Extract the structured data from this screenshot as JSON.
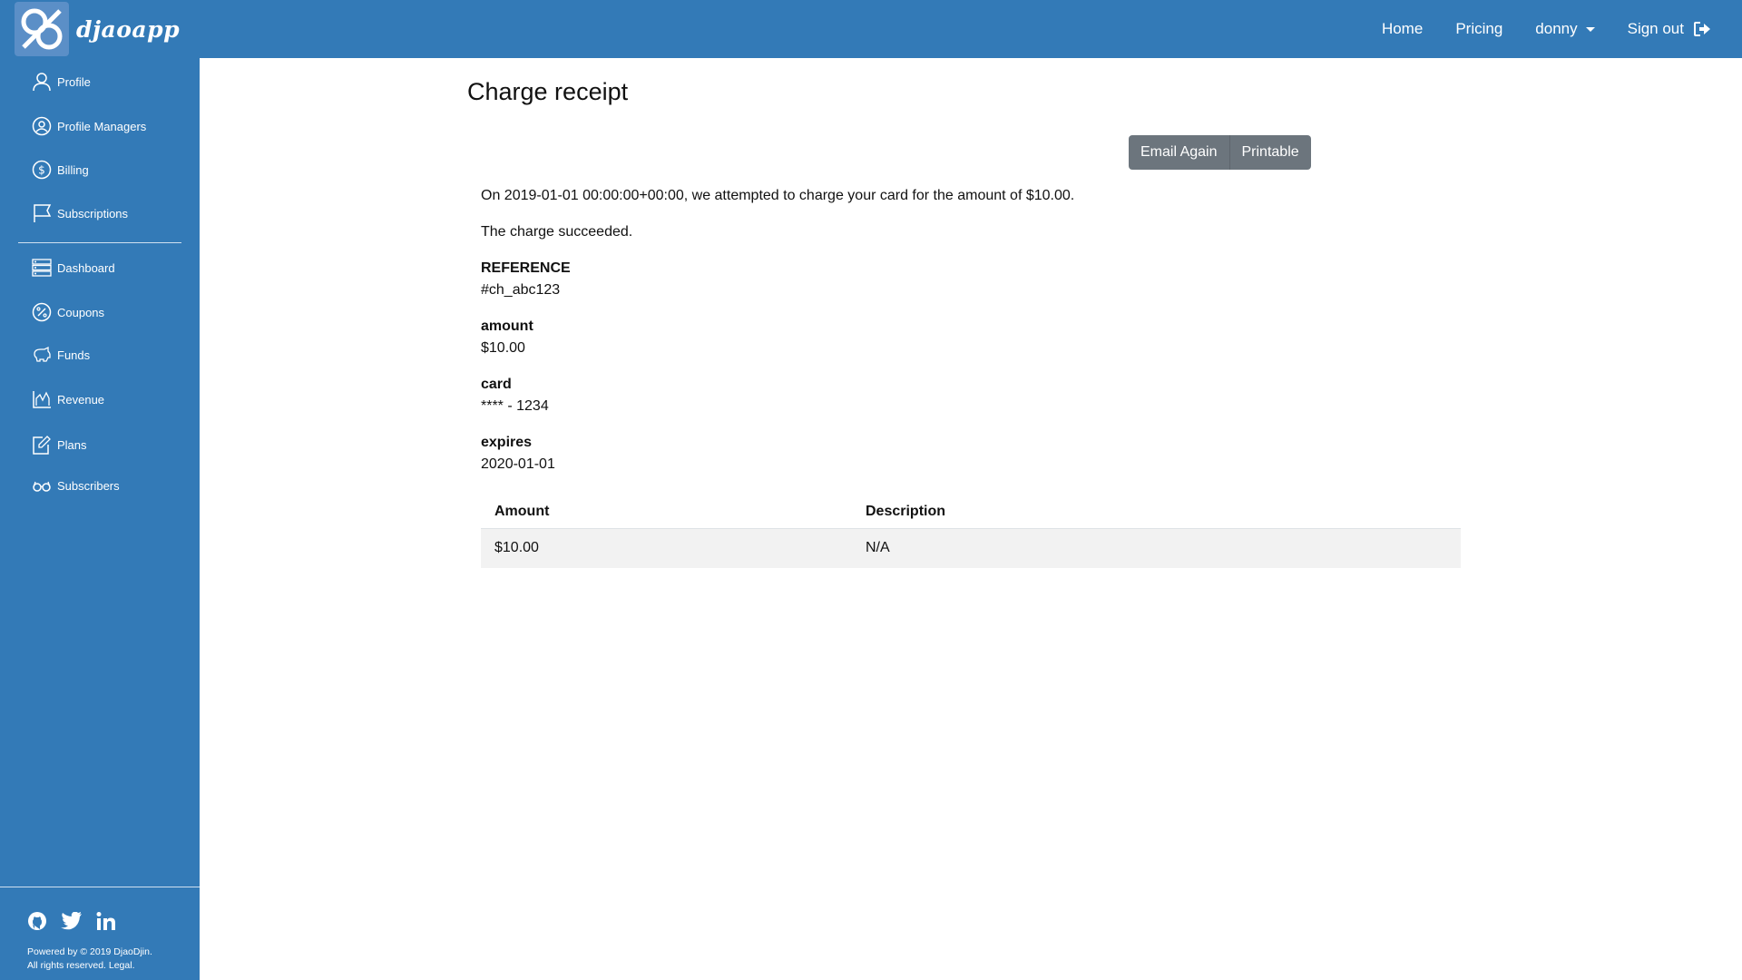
{
  "brand": {
    "name": "djaoapp"
  },
  "nav": {
    "home": "Home",
    "pricing": "Pricing",
    "user": "donny",
    "signout": "Sign out"
  },
  "sidebar": {
    "items": [
      {
        "label": "Profile",
        "icon": "user-icon"
      },
      {
        "label": "Profile Managers",
        "icon": "user-circle-icon"
      },
      {
        "label": "Billing",
        "icon": "dollar-circle-icon"
      },
      {
        "label": "Subscriptions",
        "icon": "flag-icon"
      },
      {
        "label": "Dashboard",
        "icon": "server-icon"
      },
      {
        "label": "Coupons",
        "icon": "percent-icon"
      },
      {
        "label": "Funds",
        "icon": "piggy-bank-icon"
      },
      {
        "label": "Revenue",
        "icon": "bar-chart-icon"
      },
      {
        "label": "Plans",
        "icon": "edit-icon"
      },
      {
        "label": "Subscribers",
        "icon": "glasses-icon"
      }
    ],
    "footer": {
      "powered": "Powered by © 2019 DjaoDjin.",
      "rights": "All rights reserved.",
      "legal": "Legal."
    }
  },
  "page": {
    "title": "Charge receipt",
    "buttons": {
      "email_again": "Email Again",
      "printable": "Printable"
    },
    "attempt_text": "On 2019-01-01 00:00:00+00:00, we attempted to charge your card for the amount of $10.00.",
    "status_text": "The charge succeeded.",
    "fields": [
      {
        "label": "REFERENCE",
        "value": "#ch_abc123"
      },
      {
        "label": "amount",
        "value": "$10.00"
      },
      {
        "label": "card",
        "value": "**** - 1234"
      },
      {
        "label": "expires",
        "value": "2020-01-01"
      }
    ],
    "table": {
      "headers": [
        "Amount",
        "Description"
      ],
      "rows": [
        [
          "$10.00",
          "N/A"
        ]
      ]
    }
  },
  "colors": {
    "primary": "#337ab7",
    "button": "#6c757d",
    "row_bg": "#f2f2f2"
  }
}
